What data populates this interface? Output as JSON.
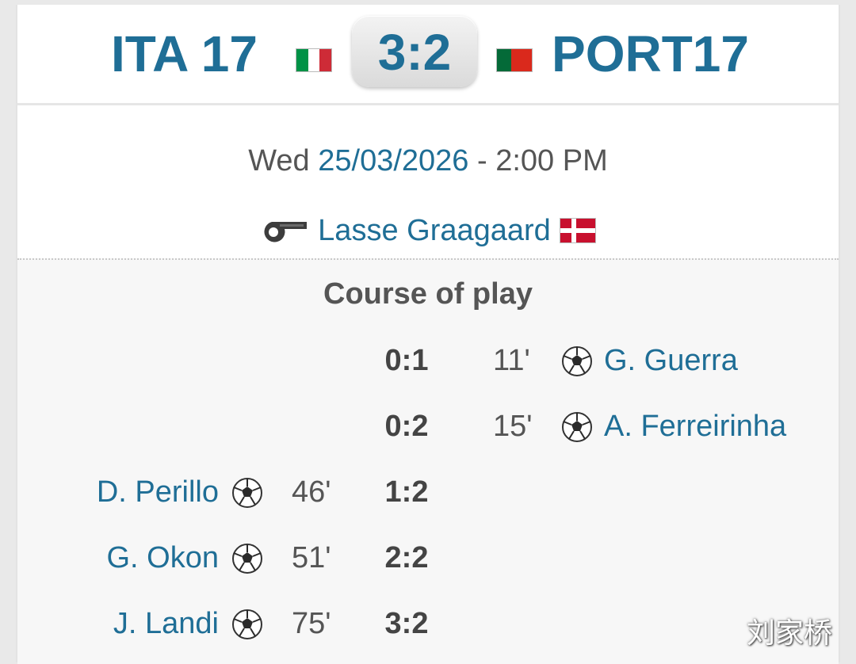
{
  "match": {
    "home_team": "ITA 17",
    "away_team": "PORT17",
    "score": "3:2"
  },
  "info": {
    "weekday": "Wed",
    "date": "25/03/2026",
    "separator": " - ",
    "time": "2:00 PM",
    "referee": "Lasse Graagaard"
  },
  "course": {
    "title": "Course of play",
    "events": [
      {
        "side": "away",
        "score": "0:1",
        "minute": "11'",
        "player": "G. Guerra"
      },
      {
        "side": "away",
        "score": "0:2",
        "minute": "15'",
        "player": "A. Ferreirinha"
      },
      {
        "side": "home",
        "score": "1:2",
        "minute": "46'",
        "player": "D. Perillo"
      },
      {
        "side": "home",
        "score": "2:2",
        "minute": "51'",
        "player": "G. Okon"
      },
      {
        "side": "home",
        "score": "3:2",
        "minute": "75'",
        "player": "J. Landi"
      }
    ]
  },
  "watermark": "刘家桥",
  "colors": {
    "link": "#1f6e96",
    "italy": [
      "#009246",
      "#ffffff",
      "#ce2b37"
    ],
    "portugal": [
      "#046a38",
      "#da291c"
    ],
    "denmark": "#c8102e"
  },
  "icons": {
    "goal": "soccer-ball-icon",
    "referee": "whistle-icon"
  }
}
